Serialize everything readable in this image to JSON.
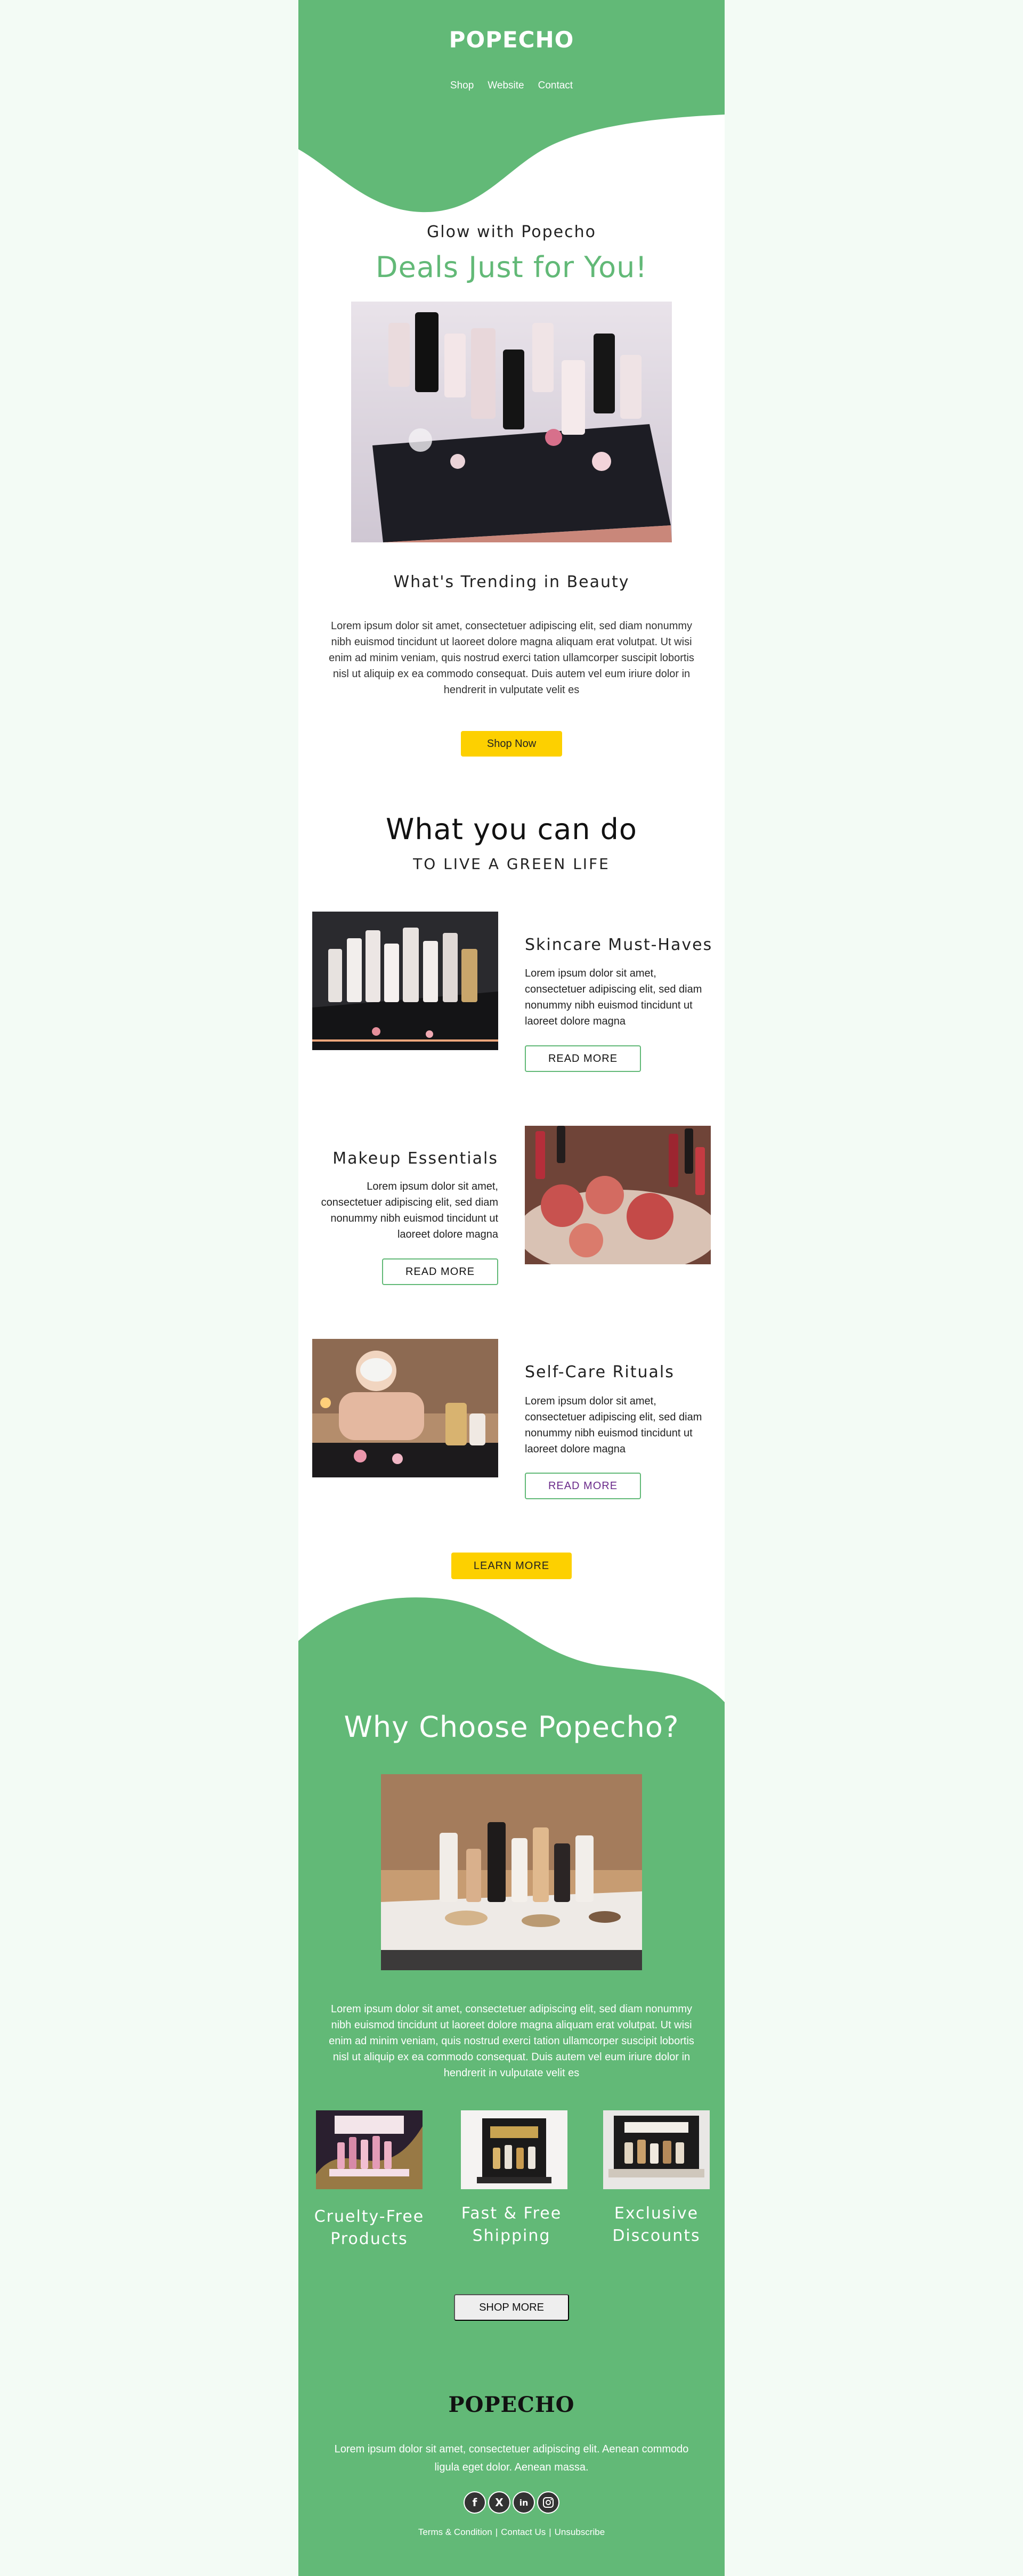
{
  "header": {
    "brand": "POPECHO",
    "nav": [
      "Shop",
      "Website",
      "Contact"
    ]
  },
  "hero": {
    "eyebrow": "Glow with Popecho",
    "title": "Deals Just for You!",
    "image_icon": "beauty-products-image"
  },
  "trending": {
    "title": "What's Trending in Beauty",
    "text": "Lorem ipsum dolor sit amet, consectetuer adipiscing elit, sed diam nonummy nibh euismod tincidunt ut laoreet dolore magna aliquam erat volutpat. Ut wisi enim ad minim veniam, quis nostrud exerci tation ullamcorper suscipit lobortis nisl ut aliquip ex ea commodo consequat. Duis autem vel eum iriure dolor in hendrerit in vulputate velit es",
    "button": "Shop Now"
  },
  "what_you_can_do": {
    "title": "What you can do",
    "subtitle": "TO LIVE A GREEN LIFE",
    "features": [
      {
        "title": "Skincare Must-Haves",
        "text": "Lorem ipsum dolor sit amet, consectetuer adipiscing elit, sed diam nonummy nibh euismod tincidunt ut laoreet dolore magna",
        "button": "READ MORE"
      },
      {
        "title": "Makeup Essentials",
        "text": "Lorem ipsum dolor sit amet, consectetuer adipiscing elit, sed diam nonummy nibh euismod tincidunt ut laoreet dolore magna",
        "button": "READ MORE"
      },
      {
        "title": "Self-Care Rituals",
        "text": "Lorem ipsum dolor sit amet, consectetuer adipiscing elit, sed diam nonummy nibh euismod tincidunt ut laoreet dolore magna",
        "button": "READ MORE"
      }
    ],
    "learn_more": "LEARN MORE"
  },
  "why": {
    "title": "Why Choose Popecho?",
    "text": "Lorem ipsum dolor sit amet, consectetuer adipiscing elit, sed diam nonummy nibh euismod tincidunt ut laoreet dolore magna aliquam erat volutpat. Ut wisi enim ad minim veniam, quis nostrud exerci tation ullamcorper suscipit lobortis nisl ut aliquip ex ea commodo consequat. Duis autem vel eum iriure dolor in hendrerit in vulputate velit es",
    "items": [
      "Cruelty-Free Products",
      "Fast & Free Shipping",
      "Exclusive Discounts"
    ],
    "button": "SHOP MORE"
  },
  "footer": {
    "brand": "POPECHO",
    "text": "Lorem ipsum dolor sit amet, consectetuer adipiscing elit. Aenean commodo ligula eget dolor. Aenean massa.",
    "socials": [
      "facebook-icon",
      "x-icon",
      "linkedin-icon",
      "instagram-icon"
    ],
    "links": [
      "Terms & Condition",
      "Contact Us",
      "Unsubscribe"
    ]
  },
  "colors": {
    "page_bg": "#f3fbf5",
    "brand_green": "#62b977",
    "accent_yellow": "#fdd000",
    "self_care_button_text": "#6a2a8a"
  }
}
